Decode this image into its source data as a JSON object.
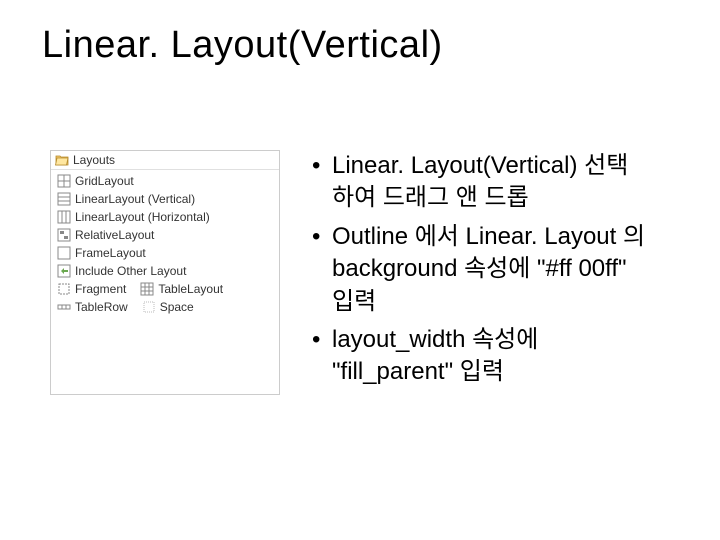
{
  "title": "Linear. Layout(Vertical)",
  "palette": {
    "header": "Layouts",
    "items": [
      "GridLayout",
      "LinearLayout (Vertical)",
      "LinearLayout (Horizontal)",
      "RelativeLayout",
      "FrameLayout",
      "Include Other Layout",
      "Fragment",
      "TableLayout",
      "TableRow",
      "Space"
    ]
  },
  "bullets": [
    "Linear. Layout(Vertical) 선택하여 드래그 앤 드롭",
    "Outline 에서 Linear. Layout 의 background 속성에 \"#ff 00ff\" 입력",
    "layout_width 속성에 \"fill_parent\" 입력"
  ]
}
